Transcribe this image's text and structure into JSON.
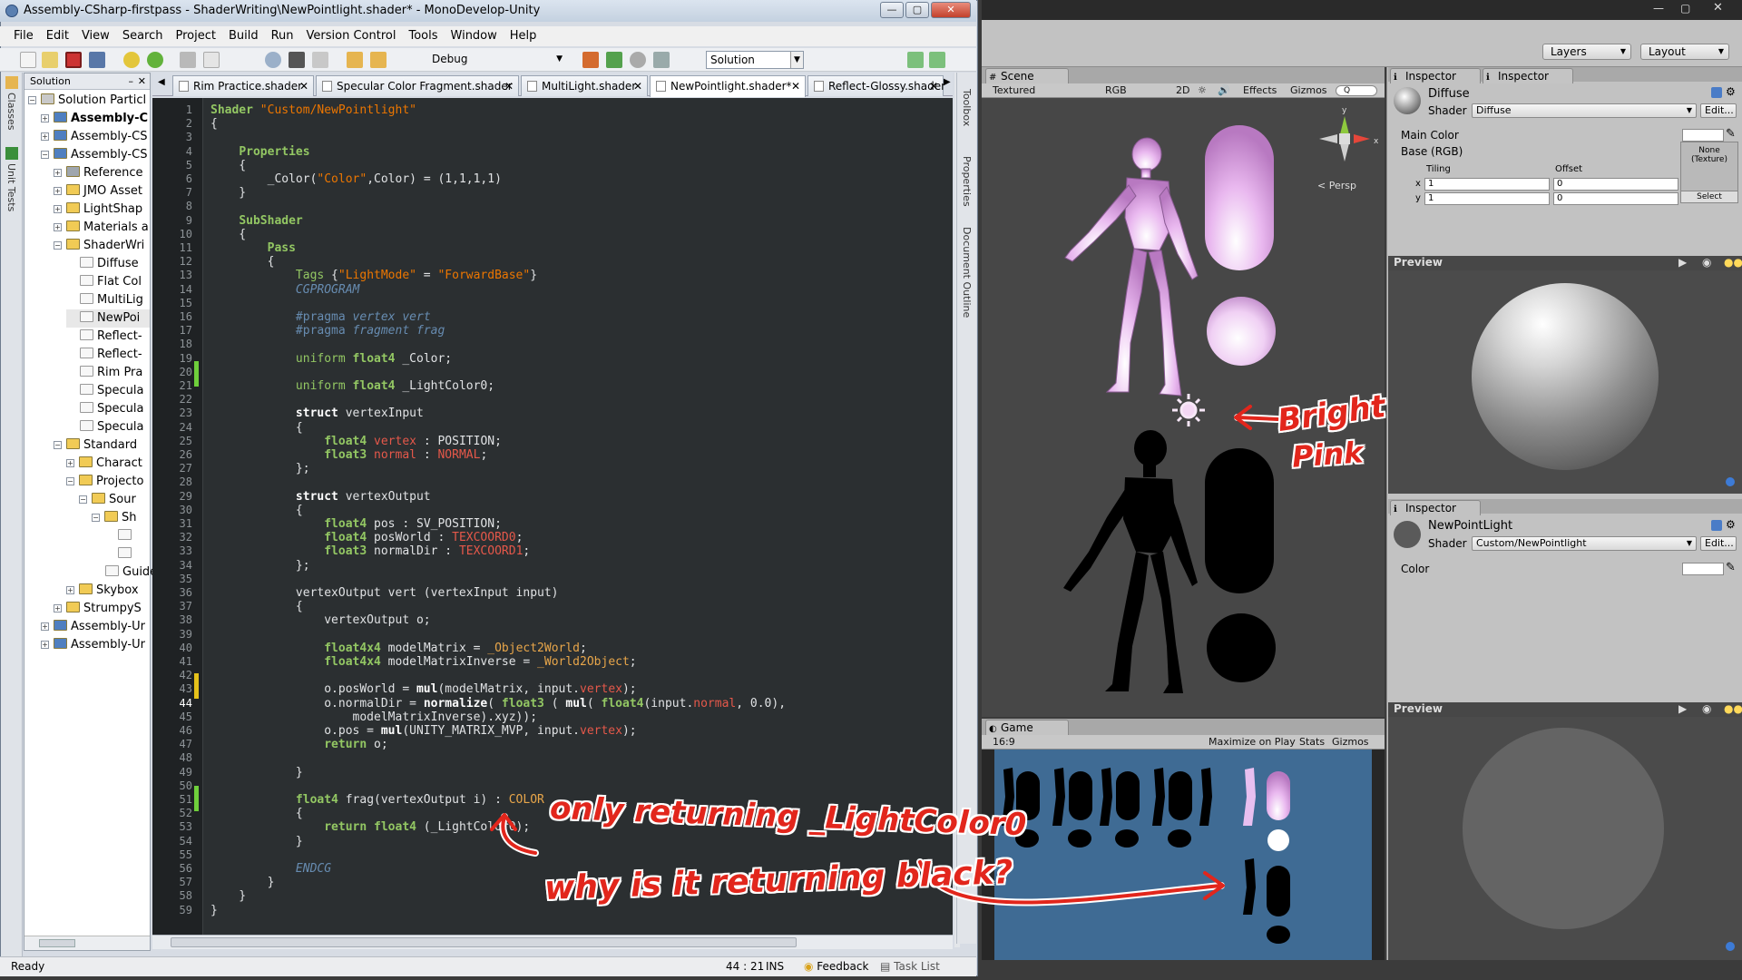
{
  "md": {
    "title": "Assembly-CSharp-firstpass - ShaderWriting\\NewPointlight.shader* - MonoDevelop-Unity",
    "menu": [
      "File",
      "Edit",
      "View",
      "Search",
      "Project",
      "Build",
      "Run",
      "Version Control",
      "Tools",
      "Window",
      "Help"
    ],
    "config": "Debug",
    "solution_dd": "Solution",
    "left_strip": [
      "Classes",
      "Unit Tests"
    ],
    "right_strip": [
      "Toolbox",
      "Properties",
      "Document Outline"
    ],
    "sol_header": "Solution",
    "tree": [
      {
        "label": "Solution Particl",
        "indent": 0,
        "exp": "−",
        "bold": false,
        "icon": "solution"
      },
      {
        "label": "Assembly-C",
        "indent": 1,
        "exp": "+",
        "bold": true,
        "icon": "project"
      },
      {
        "label": "Assembly-CS",
        "indent": 1,
        "exp": "+",
        "bold": false,
        "icon": "project"
      },
      {
        "label": "Assembly-CS",
        "indent": 1,
        "exp": "−",
        "bold": false,
        "icon": "project"
      },
      {
        "label": "Reference",
        "indent": 2,
        "exp": "+",
        "bold": false,
        "icon": "ref"
      },
      {
        "label": "JMO Asset",
        "indent": 2,
        "exp": "+",
        "bold": false,
        "icon": "folder"
      },
      {
        "label": "LightShap",
        "indent": 2,
        "exp": "+",
        "bold": false,
        "icon": "folder"
      },
      {
        "label": "Materials a",
        "indent": 2,
        "exp": "+",
        "bold": false,
        "icon": "folder"
      },
      {
        "label": "ShaderWri",
        "indent": 2,
        "exp": "−",
        "bold": false,
        "icon": "folder"
      },
      {
        "label": "Diffuse",
        "indent": 3,
        "exp": "",
        "bold": false,
        "icon": "file"
      },
      {
        "label": "Flat Col",
        "indent": 3,
        "exp": "",
        "bold": false,
        "icon": "file"
      },
      {
        "label": "MultiLig",
        "indent": 3,
        "exp": "",
        "bold": false,
        "icon": "file"
      },
      {
        "label": "NewPoi",
        "indent": 3,
        "exp": "",
        "bold": false,
        "icon": "file",
        "selected": true
      },
      {
        "label": "Reflect-",
        "indent": 3,
        "exp": "",
        "bold": false,
        "icon": "file"
      },
      {
        "label": "Reflect-",
        "indent": 3,
        "exp": "",
        "bold": false,
        "icon": "file"
      },
      {
        "label": "Rim Pra",
        "indent": 3,
        "exp": "",
        "bold": false,
        "icon": "file"
      },
      {
        "label": "Specula",
        "indent": 3,
        "exp": "",
        "bold": false,
        "icon": "file"
      },
      {
        "label": "Specula",
        "indent": 3,
        "exp": "",
        "bold": false,
        "icon": "file"
      },
      {
        "label": "Specula",
        "indent": 3,
        "exp": "",
        "bold": false,
        "icon": "file"
      },
      {
        "label": "Standard",
        "indent": 2,
        "exp": "−",
        "bold": false,
        "icon": "folder"
      },
      {
        "label": "Charact",
        "indent": 3,
        "exp": "+",
        "bold": false,
        "icon": "folder"
      },
      {
        "label": "Projecto",
        "indent": 3,
        "exp": "−",
        "bold": false,
        "icon": "folder"
      },
      {
        "label": "Sour",
        "indent": 4,
        "exp": "−",
        "bold": false,
        "icon": "folder"
      },
      {
        "label": "Sh",
        "indent": 5,
        "exp": "−",
        "bold": false,
        "icon": "folder"
      },
      {
        "label": "",
        "indent": 6,
        "exp": "",
        "bold": false,
        "icon": "file"
      },
      {
        "label": "",
        "indent": 6,
        "exp": "",
        "bold": false,
        "icon": "file"
      },
      {
        "label": "Guide",
        "indent": 5,
        "exp": "",
        "bold": false,
        "icon": "file"
      },
      {
        "label": "Skybox",
        "indent": 3,
        "exp": "+",
        "bold": false,
        "icon": "folder"
      },
      {
        "label": "StrumpyS",
        "indent": 2,
        "exp": "+",
        "bold": false,
        "icon": "folder"
      },
      {
        "label": "Assembly-Ur",
        "indent": 1,
        "exp": "+",
        "bold": false,
        "icon": "project"
      },
      {
        "label": "Assembly-Ur",
        "indent": 1,
        "exp": "+",
        "bold": false,
        "icon": "project"
      }
    ],
    "tabs": [
      "Rim Practice.shader",
      "Specular Color Fragment.shader",
      "MultiLight.shader",
      "NewPointlight.shader*",
      "Reflect-Glossy.shader"
    ],
    "active_tab": 3,
    "code": [
      [
        [
          "kw",
          "Shader "
        ],
        [
          "st",
          "\"Custom/NewPointlight\""
        ]
      ],
      [
        [
          "sem",
          "{"
        ]
      ],
      [],
      [
        [
          "sem",
          "    "
        ],
        [
          "kw",
          "Properties"
        ]
      ],
      [
        [
          "sem",
          "    {"
        ]
      ],
      [
        [
          "sem",
          "        _Color("
        ],
        [
          "st",
          "\"Color\""
        ],
        [
          "sem",
          ",Color) = (1,1,1,1)"
        ]
      ],
      [
        [
          "sem",
          "    }"
        ]
      ],
      [],
      [
        [
          "sem",
          "    "
        ],
        [
          "kw",
          "SubShader"
        ]
      ],
      [
        [
          "sem",
          "    {"
        ]
      ],
      [
        [
          "sem",
          "        "
        ],
        [
          "kw",
          "Pass"
        ]
      ],
      [
        [
          "sem",
          "        {"
        ]
      ],
      [
        [
          "sem",
          "            "
        ],
        [
          "ty",
          "Tags"
        ],
        [
          "sem",
          " {"
        ],
        [
          "st",
          "\"LightMode\""
        ],
        [
          "sem",
          " = "
        ],
        [
          "st",
          "\"ForwardBase\""
        ],
        [
          "sem",
          "}"
        ]
      ],
      [
        [
          "sem",
          "            "
        ],
        [
          "it",
          "CGPROGRAM"
        ]
      ],
      [],
      [
        [
          "sem",
          "            "
        ],
        [
          "pr",
          "#pragma "
        ],
        [
          "it",
          "vertex vert"
        ]
      ],
      [
        [
          "sem",
          "            "
        ],
        [
          "pr",
          "#pragma "
        ],
        [
          "it",
          "fragment frag"
        ]
      ],
      [],
      [
        [
          "sem",
          "            "
        ],
        [
          "ty",
          "uniform "
        ],
        [
          "kw",
          "float4"
        ],
        [
          "sem",
          " _Color;"
        ]
      ],
      [],
      [
        [
          "sem",
          "            "
        ],
        [
          "ty",
          "uniform "
        ],
        [
          "kw",
          "float4"
        ],
        [
          "sem",
          " _LightColor0;"
        ]
      ],
      [],
      [
        [
          "sem",
          "            "
        ],
        [
          "fn",
          "struct"
        ],
        [
          "sem",
          " vertexInput"
        ]
      ],
      [
        [
          "sem",
          "            {"
        ]
      ],
      [
        [
          "sem",
          "                "
        ],
        [
          "kw",
          "float4"
        ],
        [
          "red",
          " vertex"
        ],
        [
          "sem",
          " : POSITION;"
        ]
      ],
      [
        [
          "sem",
          "                "
        ],
        [
          "kw",
          "float3"
        ],
        [
          "red",
          " normal"
        ],
        [
          "sem",
          " : "
        ],
        [
          "red",
          "NORMAL"
        ],
        [
          "sem",
          ";"
        ]
      ],
      [
        [
          "sem",
          "            };"
        ]
      ],
      [],
      [
        [
          "sem",
          "            "
        ],
        [
          "fn",
          "struct"
        ],
        [
          "sem",
          " vertexOutput"
        ]
      ],
      [
        [
          "sem",
          "            {"
        ]
      ],
      [
        [
          "sem",
          "                "
        ],
        [
          "kw",
          "float4"
        ],
        [
          "sem",
          " pos : SV_POSITION;"
        ]
      ],
      [
        [
          "sem",
          "                "
        ],
        [
          "kw",
          "float4"
        ],
        [
          "sem",
          " posWorld : "
        ],
        [
          "red",
          "TEXCOORD0"
        ],
        [
          "sem",
          ";"
        ]
      ],
      [
        [
          "sem",
          "                "
        ],
        [
          "kw",
          "float3"
        ],
        [
          "sem",
          " normalDir : "
        ],
        [
          "red",
          "TEXCOORD1"
        ],
        [
          "sem",
          ";"
        ]
      ],
      [
        [
          "sem",
          "            };"
        ]
      ],
      [],
      [
        [
          "sem",
          "            vertexOutput vert (vertexInput input)"
        ]
      ],
      [
        [
          "sem",
          "            {"
        ]
      ],
      [
        [
          "sem",
          "                vertexOutput o;"
        ]
      ],
      [],
      [
        [
          "sem",
          "                "
        ],
        [
          "kw",
          "float4x4"
        ],
        [
          "sem",
          " modelMatrix = "
        ],
        [
          "sy",
          "_Object2World"
        ],
        [
          "sem",
          ";"
        ]
      ],
      [
        [
          "sem",
          "                "
        ],
        [
          "kw",
          "float4x4"
        ],
        [
          "sem",
          " modelMatrixInverse = "
        ],
        [
          "sy",
          "_World2Object"
        ],
        [
          "sem",
          ";"
        ]
      ],
      [],
      [
        [
          "sem",
          "                o.posWorld = "
        ],
        [
          "fn",
          "mul"
        ],
        [
          "sem",
          "(modelMatrix, input."
        ],
        [
          "red",
          "vertex"
        ],
        [
          "sem",
          ");"
        ]
      ],
      [
        [
          "sem",
          "                o.normalDir = "
        ],
        [
          "fn",
          "normalize"
        ],
        [
          "sem",
          "( "
        ],
        [
          "kw",
          "float3"
        ],
        [
          "sem",
          " ( "
        ],
        [
          "fn",
          "mul"
        ],
        [
          "sem",
          "( "
        ],
        [
          "kw",
          "float4"
        ],
        [
          "sem",
          "(input."
        ],
        [
          "red",
          "normal"
        ],
        [
          "sem",
          ", 0.0),"
        ]
      ],
      [
        [
          "sem",
          "                    modelMatrixInverse).xyz));"
        ]
      ],
      [
        [
          "sem",
          "                o.pos = "
        ],
        [
          "fn",
          "mul"
        ],
        [
          "sem",
          "(UNITY_MATRIX_MVP, input."
        ],
        [
          "red",
          "vertex"
        ],
        [
          "sem",
          ");"
        ]
      ],
      [
        [
          "sem",
          "                "
        ],
        [
          "kw",
          "return"
        ],
        [
          "sem",
          " o;"
        ]
      ],
      [],
      [
        [
          "sem",
          "            }"
        ]
      ],
      [],
      [
        [
          "sem",
          "            "
        ],
        [
          "kw",
          "float4"
        ],
        [
          "sem",
          " frag(vertexOutput i) : "
        ],
        [
          "sy",
          "COLOR"
        ]
      ],
      [
        [
          "sem",
          "            {"
        ]
      ],
      [
        [
          "sem",
          "                "
        ],
        [
          "kw",
          "return float4"
        ],
        [
          "sem",
          " (_LightColor0);"
        ]
      ],
      [
        [
          "sem",
          "            }"
        ]
      ],
      [],
      [
        [
          "sem",
          "            "
        ],
        [
          "it",
          "ENDCG"
        ]
      ],
      [
        [
          "sem",
          "        }"
        ]
      ],
      [
        [
          "sem",
          "    }"
        ]
      ],
      [
        [
          "sem",
          "}"
        ]
      ]
    ],
    "current_line": 44,
    "status": {
      "left": "Ready",
      "pos": "44 : 21",
      "mode": "INS",
      "feedback": "Feedback",
      "tasks": "Task List"
    }
  },
  "unity": {
    "layers": "Layers",
    "layout": "Layout",
    "scene_tab": "Scene",
    "scene_tools": [
      "Textured",
      "RGB",
      "2D",
      "☼",
      "🔊",
      "Effects",
      "Gizmos",
      "Q"
    ],
    "persp": "< Persp",
    "game_tab": "Game",
    "game_tools": {
      "aspect": "16:9",
      "maximize": "Maximize on Play",
      "stats": "Stats",
      "gizmos": "Gizmos"
    },
    "insp1": {
      "tab1": "Inspector",
      "tab2": "Inspector",
      "material": "Diffuse",
      "shader_label": "Shader",
      "shader": "Diffuse",
      "edit": "Edit...",
      "main_color": "Main Color",
      "base": "Base (RGB)",
      "tiling": "Tiling",
      "offset": "Offset",
      "x": "x",
      "y": "y",
      "tx": "1",
      "ty": "1",
      "ox": "0",
      "oy": "0",
      "none": "None",
      "texture": "(Texture)",
      "select": "Select"
    },
    "preview": "Preview",
    "insp2": {
      "tab": "Inspector",
      "material": "NewPointLight",
      "shader_label": "Shader",
      "shader": "Custom/NewPointlight",
      "edit": "Edit...",
      "color": "Color"
    },
    "preview2": "Preview"
  },
  "annotations": {
    "bright": "Bright",
    "pink": "Pink",
    "line1": "only returning _LightColor0",
    "line2": "why is it returning black?"
  },
  "colors": {
    "pink_figure": "#e7b5ec",
    "annotation": "#e2261c",
    "game_bg": "#3f6b94"
  }
}
